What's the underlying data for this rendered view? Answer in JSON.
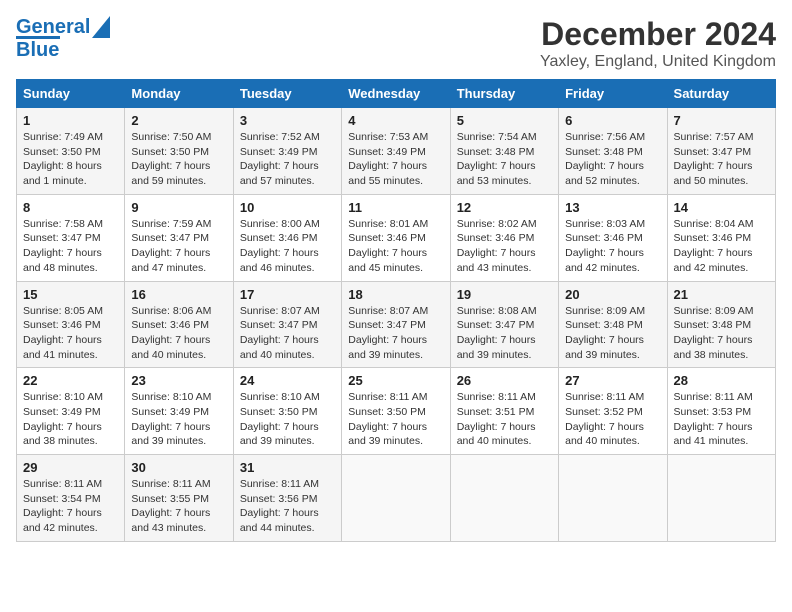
{
  "header": {
    "logo_line1": "General",
    "logo_line2": "Blue",
    "month": "December 2024",
    "location": "Yaxley, England, United Kingdom"
  },
  "days_of_week": [
    "Sunday",
    "Monday",
    "Tuesday",
    "Wednesday",
    "Thursday",
    "Friday",
    "Saturday"
  ],
  "weeks": [
    [
      {
        "day": "1",
        "sunrise": "Sunrise: 7:49 AM",
        "sunset": "Sunset: 3:50 PM",
        "daylight": "Daylight: 8 hours and 1 minute."
      },
      {
        "day": "2",
        "sunrise": "Sunrise: 7:50 AM",
        "sunset": "Sunset: 3:50 PM",
        "daylight": "Daylight: 7 hours and 59 minutes."
      },
      {
        "day": "3",
        "sunrise": "Sunrise: 7:52 AM",
        "sunset": "Sunset: 3:49 PM",
        "daylight": "Daylight: 7 hours and 57 minutes."
      },
      {
        "day": "4",
        "sunrise": "Sunrise: 7:53 AM",
        "sunset": "Sunset: 3:49 PM",
        "daylight": "Daylight: 7 hours and 55 minutes."
      },
      {
        "day": "5",
        "sunrise": "Sunrise: 7:54 AM",
        "sunset": "Sunset: 3:48 PM",
        "daylight": "Daylight: 7 hours and 53 minutes."
      },
      {
        "day": "6",
        "sunrise": "Sunrise: 7:56 AM",
        "sunset": "Sunset: 3:48 PM",
        "daylight": "Daylight: 7 hours and 52 minutes."
      },
      {
        "day": "7",
        "sunrise": "Sunrise: 7:57 AM",
        "sunset": "Sunset: 3:47 PM",
        "daylight": "Daylight: 7 hours and 50 minutes."
      }
    ],
    [
      {
        "day": "8",
        "sunrise": "Sunrise: 7:58 AM",
        "sunset": "Sunset: 3:47 PM",
        "daylight": "Daylight: 7 hours and 48 minutes."
      },
      {
        "day": "9",
        "sunrise": "Sunrise: 7:59 AM",
        "sunset": "Sunset: 3:47 PM",
        "daylight": "Daylight: 7 hours and 47 minutes."
      },
      {
        "day": "10",
        "sunrise": "Sunrise: 8:00 AM",
        "sunset": "Sunset: 3:46 PM",
        "daylight": "Daylight: 7 hours and 46 minutes."
      },
      {
        "day": "11",
        "sunrise": "Sunrise: 8:01 AM",
        "sunset": "Sunset: 3:46 PM",
        "daylight": "Daylight: 7 hours and 45 minutes."
      },
      {
        "day": "12",
        "sunrise": "Sunrise: 8:02 AM",
        "sunset": "Sunset: 3:46 PM",
        "daylight": "Daylight: 7 hours and 43 minutes."
      },
      {
        "day": "13",
        "sunrise": "Sunrise: 8:03 AM",
        "sunset": "Sunset: 3:46 PM",
        "daylight": "Daylight: 7 hours and 42 minutes."
      },
      {
        "day": "14",
        "sunrise": "Sunrise: 8:04 AM",
        "sunset": "Sunset: 3:46 PM",
        "daylight": "Daylight: 7 hours and 42 minutes."
      }
    ],
    [
      {
        "day": "15",
        "sunrise": "Sunrise: 8:05 AM",
        "sunset": "Sunset: 3:46 PM",
        "daylight": "Daylight: 7 hours and 41 minutes."
      },
      {
        "day": "16",
        "sunrise": "Sunrise: 8:06 AM",
        "sunset": "Sunset: 3:46 PM",
        "daylight": "Daylight: 7 hours and 40 minutes."
      },
      {
        "day": "17",
        "sunrise": "Sunrise: 8:07 AM",
        "sunset": "Sunset: 3:47 PM",
        "daylight": "Daylight: 7 hours and 40 minutes."
      },
      {
        "day": "18",
        "sunrise": "Sunrise: 8:07 AM",
        "sunset": "Sunset: 3:47 PM",
        "daylight": "Daylight: 7 hours and 39 minutes."
      },
      {
        "day": "19",
        "sunrise": "Sunrise: 8:08 AM",
        "sunset": "Sunset: 3:47 PM",
        "daylight": "Daylight: 7 hours and 39 minutes."
      },
      {
        "day": "20",
        "sunrise": "Sunrise: 8:09 AM",
        "sunset": "Sunset: 3:48 PM",
        "daylight": "Daylight: 7 hours and 39 minutes."
      },
      {
        "day": "21",
        "sunrise": "Sunrise: 8:09 AM",
        "sunset": "Sunset: 3:48 PM",
        "daylight": "Daylight: 7 hours and 38 minutes."
      }
    ],
    [
      {
        "day": "22",
        "sunrise": "Sunrise: 8:10 AM",
        "sunset": "Sunset: 3:49 PM",
        "daylight": "Daylight: 7 hours and 38 minutes."
      },
      {
        "day": "23",
        "sunrise": "Sunrise: 8:10 AM",
        "sunset": "Sunset: 3:49 PM",
        "daylight": "Daylight: 7 hours and 39 minutes."
      },
      {
        "day": "24",
        "sunrise": "Sunrise: 8:10 AM",
        "sunset": "Sunset: 3:50 PM",
        "daylight": "Daylight: 7 hours and 39 minutes."
      },
      {
        "day": "25",
        "sunrise": "Sunrise: 8:11 AM",
        "sunset": "Sunset: 3:50 PM",
        "daylight": "Daylight: 7 hours and 39 minutes."
      },
      {
        "day": "26",
        "sunrise": "Sunrise: 8:11 AM",
        "sunset": "Sunset: 3:51 PM",
        "daylight": "Daylight: 7 hours and 40 minutes."
      },
      {
        "day": "27",
        "sunrise": "Sunrise: 8:11 AM",
        "sunset": "Sunset: 3:52 PM",
        "daylight": "Daylight: 7 hours and 40 minutes."
      },
      {
        "day": "28",
        "sunrise": "Sunrise: 8:11 AM",
        "sunset": "Sunset: 3:53 PM",
        "daylight": "Daylight: 7 hours and 41 minutes."
      }
    ],
    [
      {
        "day": "29",
        "sunrise": "Sunrise: 8:11 AM",
        "sunset": "Sunset: 3:54 PM",
        "daylight": "Daylight: 7 hours and 42 minutes."
      },
      {
        "day": "30",
        "sunrise": "Sunrise: 8:11 AM",
        "sunset": "Sunset: 3:55 PM",
        "daylight": "Daylight: 7 hours and 43 minutes."
      },
      {
        "day": "31",
        "sunrise": "Sunrise: 8:11 AM",
        "sunset": "Sunset: 3:56 PM",
        "daylight": "Daylight: 7 hours and 44 minutes."
      },
      null,
      null,
      null,
      null
    ]
  ]
}
